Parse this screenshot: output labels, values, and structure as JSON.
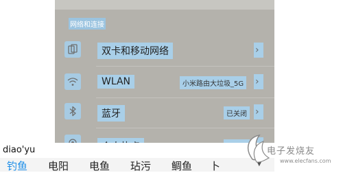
{
  "settings": {
    "section_header": "网络和连接",
    "rows": [
      {
        "title": "双卡和移动网络",
        "value": "",
        "icon": "sim-cards-icon"
      },
      {
        "title": "WLAN",
        "value": "小米路由大垃圾_5G",
        "icon": "wifi-icon"
      },
      {
        "title": "蓝牙",
        "value": "已关闭",
        "icon": "bluetooth-icon"
      },
      {
        "title": "个人热点",
        "value": "已关闭",
        "icon": "hotspot-icon"
      }
    ],
    "chevron": "›"
  },
  "ime": {
    "composing_text": "diao'yu",
    "candidates": [
      "钓鱼",
      "电阳",
      "电鱼",
      "玷污",
      "鲷鱼",
      "卜"
    ],
    "active_candidate_index": 0,
    "more_symbol": "▼",
    "active_color": "#1f8fe8"
  },
  "watermark": {
    "brand": "电子发烧友",
    "url": "www.elecfans.com"
  }
}
